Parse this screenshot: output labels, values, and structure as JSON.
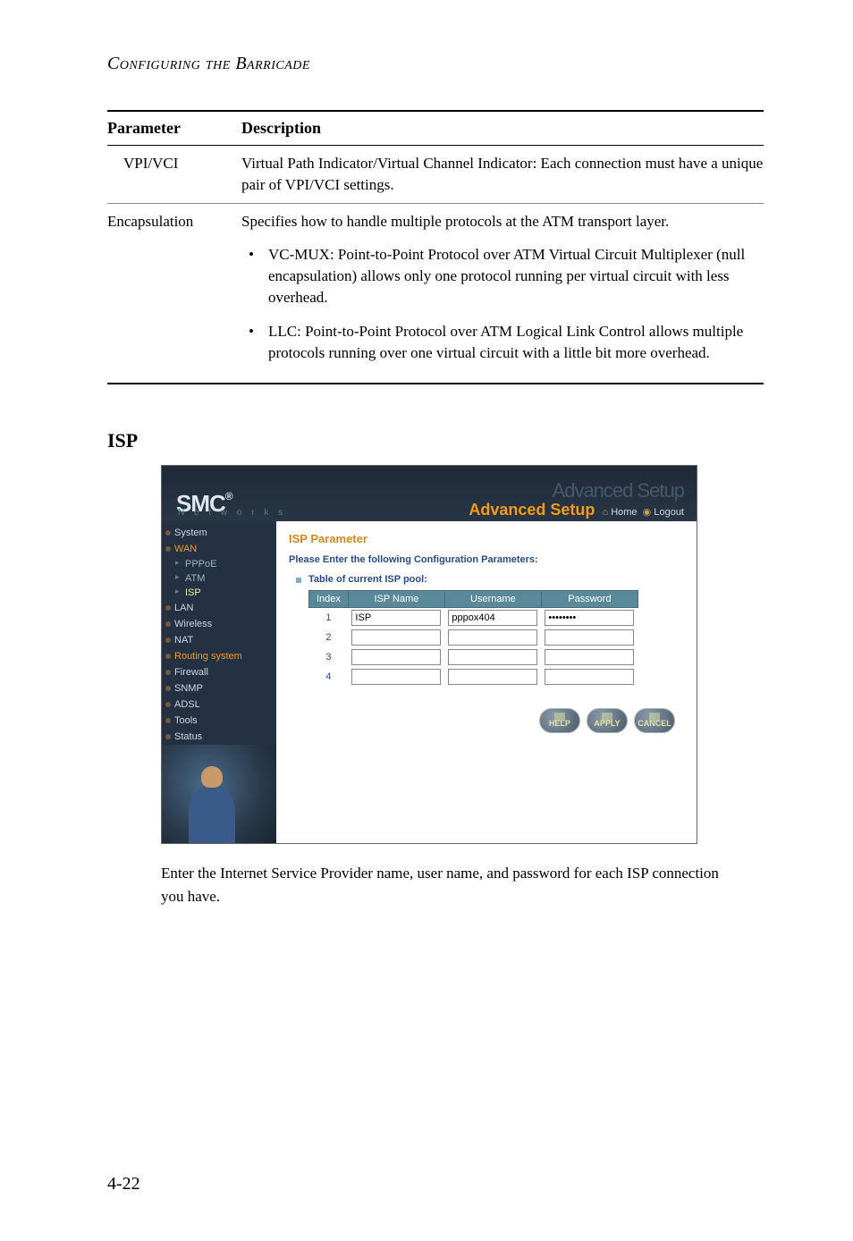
{
  "chapter_title": "Configuring the Barricade",
  "table": {
    "headers": {
      "param": "Parameter",
      "desc": "Description"
    },
    "rows": [
      {
        "param": "VPI/VCI",
        "desc": "Virtual Path Indicator/Virtual Channel Indicator: Each connection must have a unique pair of VPI/VCI settings."
      },
      {
        "param": "Encapsulation",
        "desc": "Specifies how to handle multiple protocols at the ATM transport layer.",
        "bullets": [
          "VC-MUX: Point-to-Point Protocol over ATM Virtual Circuit Multiplexer (null encapsulation) allows only one protocol running per virtual circuit with less overhead.",
          "LLC: Point-to-Point Protocol over ATM Logical Link Control allows multiple protocols running over one virtual circuit with a little bit more overhead."
        ]
      }
    ]
  },
  "section_heading": "ISP",
  "router": {
    "brand": "SMC",
    "brand_reg": "®",
    "networks": "N e t w o r k s",
    "banner_ghost": "Advanced Setup",
    "banner_advanced": "Advanced ",
    "banner_setup": "Setup",
    "home": "Home",
    "logout": "Logout",
    "sidebar": {
      "system": "System",
      "wan": "WAN",
      "pppoe": "PPPoE",
      "atm": "ATM",
      "isp": "ISP",
      "lan": "LAN",
      "wireless": "Wireless",
      "nat": "NAT",
      "routing": "Routing system",
      "firewall": "Firewall",
      "snmp": "SNMP",
      "adsl": "ADSL",
      "tools": "Tools",
      "status": "Status"
    },
    "content": {
      "heading": "ISP Parameter",
      "subheading": "Please Enter the following Configuration Parameters:",
      "table_label": "Table of current ISP pool:",
      "columns": {
        "index": "Index",
        "isp_name": "ISP Name",
        "username": "Username",
        "password": "Password"
      },
      "rows": [
        {
          "index": "1",
          "isp_name": "ISP",
          "username": "pppox404",
          "password": "********"
        },
        {
          "index": "2",
          "isp_name": "",
          "username": "",
          "password": ""
        },
        {
          "index": "3",
          "isp_name": "",
          "username": "",
          "password": ""
        },
        {
          "index": "4",
          "isp_name": "",
          "username": "",
          "password": ""
        }
      ],
      "buttons": {
        "help": "HELP",
        "apply": "APPLY",
        "cancel": "CANCEL"
      }
    }
  },
  "caption": "Enter the Internet Service Provider name, user name, and password for each ISP connection you have.",
  "page_number": "4-22"
}
